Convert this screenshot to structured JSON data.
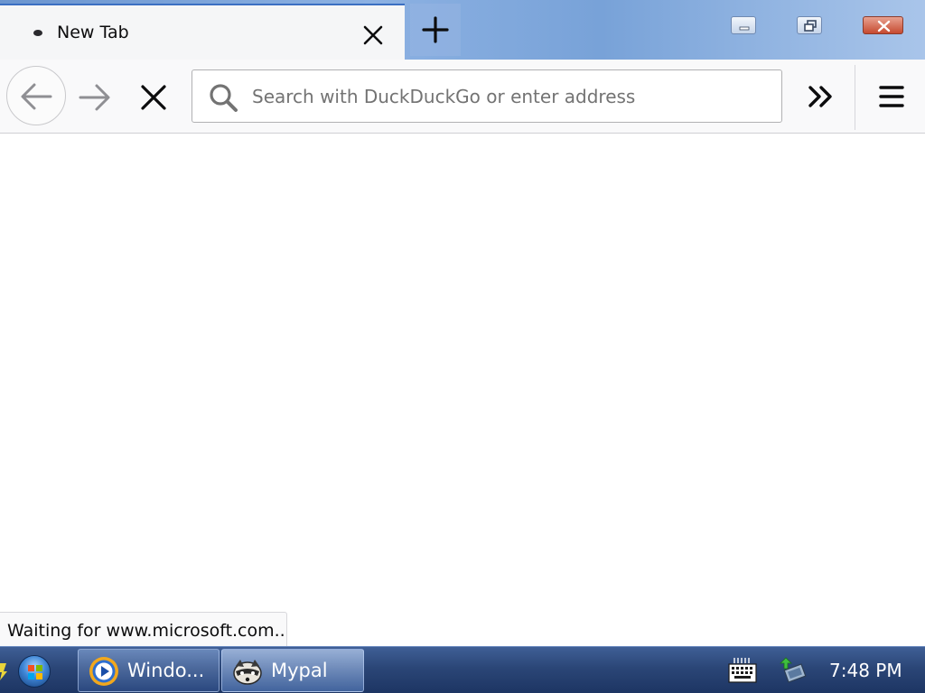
{
  "browser": {
    "tab": {
      "title": "New Tab",
      "close_icon": "close-icon"
    },
    "new_tab_icon": "plus-icon",
    "window_controls": [
      "minimize-icon",
      "restore-icon",
      "close-icon"
    ],
    "toolbar": {
      "back_icon": "arrow-left-icon",
      "forward_icon": "arrow-right-icon",
      "stop_icon": "close-icon",
      "url_placeholder": "Search with DuckDuckGo or enter address",
      "url_value": "",
      "overflow_icon": "double-chevron-right-icon",
      "menu_icon": "hamburger-menu-icon"
    },
    "status_text": "Waiting for www.microsoft.com..."
  },
  "taskbar": {
    "start_icon": "windows-start-icon",
    "items": [
      {
        "label": "Windo...",
        "icon": "windows-media-player-icon",
        "active": false
      },
      {
        "label": "Mypal",
        "icon": "mypal-raccoon-icon",
        "active": true
      }
    ],
    "tray": {
      "keyboard_icon": "keyboard-icon",
      "network_icon": "network-icon"
    },
    "clock": "7:48 PM"
  },
  "colors": {
    "tab_accent": "#3b6fc2",
    "toolbar_bg": "#f9f9fa",
    "taskbar_bg": "#2b4677",
    "close_button": "#c64a30"
  }
}
